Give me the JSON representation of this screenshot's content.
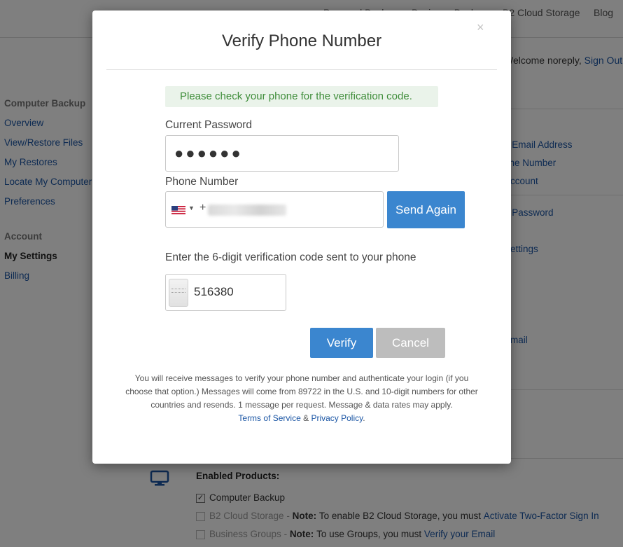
{
  "topnav": {
    "links": [
      "Personal Backup",
      "Business Backup",
      "B2 Cloud Storage",
      "Blog"
    ]
  },
  "welcome": {
    "text": "Welcome noreply,",
    "sign_out": "Sign Out"
  },
  "sidebar": {
    "section1": "Computer Backup",
    "items1": [
      "Overview",
      "View/Restore Files",
      "My Restores",
      "Locate My Computer",
      "Preferences"
    ],
    "section2": "Account",
    "items2": [
      "My Settings",
      "Billing"
    ]
  },
  "right_links": [
    "e Email Address",
    "one Number",
    "Account",
    "e Password",
    "Settings",
    "Email"
  ],
  "enabled_products": {
    "title": "Enabled Products:",
    "computer_backup": "Computer Backup",
    "b2": "B2 Cloud Storage",
    "b2_note_label": "Note:",
    "b2_note": "To enable B2 Cloud Storage, you must",
    "b2_link": "Activate Two-Factor Sign In",
    "groups": "Business Groups",
    "groups_note_label": "Note:",
    "groups_note": "To use Groups, you must",
    "groups_link": "Verify your Email"
  },
  "modal": {
    "title": "Verify Phone Number",
    "close": "×",
    "alert": "Please check your phone for the verification code.",
    "password_label": "Current Password",
    "password_value": "●●●●●●",
    "phone_label": "Phone Number",
    "phone_prefix": "+",
    "send_again": "Send Again",
    "code_label": "Enter the 6-digit verification code sent to your phone",
    "code_value": "516380",
    "verify": "Verify",
    "cancel": "Cancel",
    "footnote": "You will receive messages to verify your phone number and authenticate your login (if you choose that option.) Messages will come from 89722 in the U.S. and 10-digit numbers for other countries and resends. 1 message per request. Message & data rates may apply.",
    "terms": "Terms of Service",
    "amp": "&",
    "privacy": "Privacy Policy",
    "period": "."
  },
  "colors": {
    "primary": "#3b86cf",
    "link": "#1a55a4",
    "success_text": "#3f8d3a",
    "success_bg": "#eaf3ea",
    "cancel": "#bdbdbd"
  }
}
